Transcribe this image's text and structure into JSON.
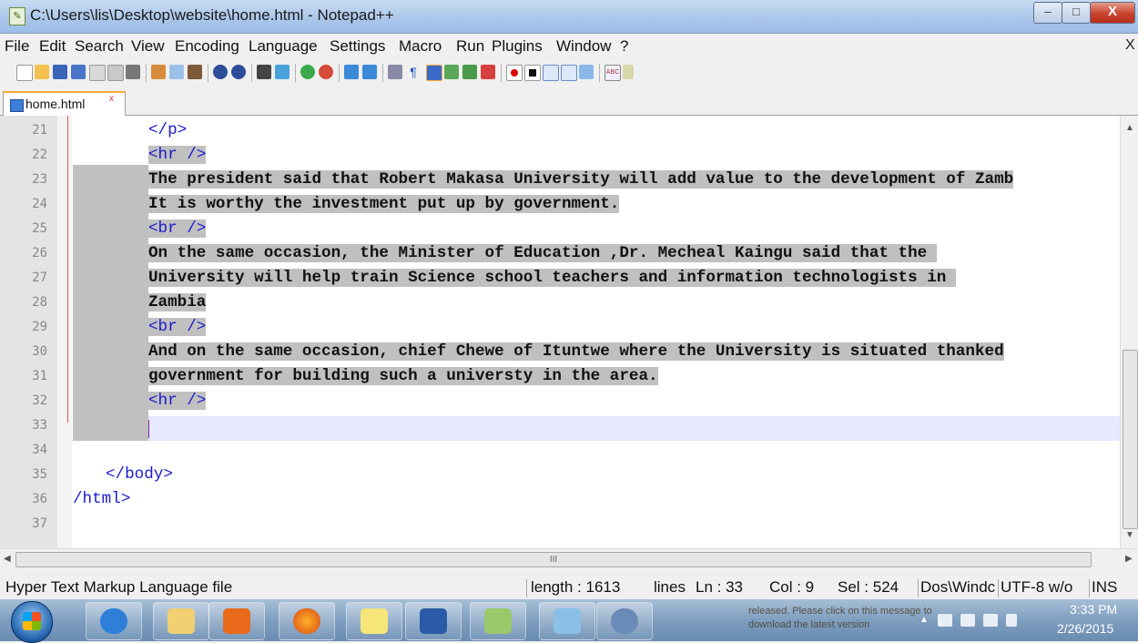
{
  "window": {
    "title": "C:\\Users\\lis\\Desktop\\website\\home.html - Notepad++",
    "minimize": "–",
    "maximize": "□",
    "close": "X"
  },
  "menu": {
    "items": [
      "File",
      "Edit",
      "Search",
      "View",
      "Encoding",
      "Language",
      "Settings",
      "Macro",
      "Run",
      "Plugins",
      "Window",
      "?"
    ],
    "close": "X"
  },
  "tabs": [
    {
      "label": "home.html",
      "close": "x"
    }
  ],
  "editor": {
    "lines": [
      {
        "num": "21",
        "text": "</p>",
        "indent": "        ",
        "kind": "tag"
      },
      {
        "num": "22",
        "text": "<hr />",
        "kind": "tag-sel"
      },
      {
        "num": "23",
        "text": "The president said that Robert Makasa University will add value to the development of Zamb",
        "kind": "text-sel"
      },
      {
        "num": "24",
        "text": "It is worthy the investment put up by government.",
        "kind": "text-sel"
      },
      {
        "num": "25",
        "text": "<br />",
        "kind": "tag-sel"
      },
      {
        "num": "26",
        "text": "On the same occasion, the Minister of Education ,Dr. Mecheal Kaingu said that the ",
        "kind": "text-sel"
      },
      {
        "num": "27",
        "text": "University will help train Science school teachers and information technologists in ",
        "kind": "text-sel"
      },
      {
        "num": "28",
        "text": "Zambia",
        "kind": "text-sel"
      },
      {
        "num": "29",
        "text": "<br />",
        "kind": "tag-sel"
      },
      {
        "num": "30",
        "text": "And on the same occasion, chief Chewe of Ituntwe where the University is situated thanked",
        "kind": "text-sel"
      },
      {
        "num": "31",
        "text": "government for building such a universty in the area.",
        "kind": "text-sel"
      },
      {
        "num": "32",
        "text": "<hr />",
        "kind": "tag-sel"
      },
      {
        "num": "33",
        "text": "",
        "kind": "current"
      },
      {
        "num": "34",
        "text": "",
        "kind": "blank"
      },
      {
        "num": "35",
        "text": "</body>",
        "kind": "tag"
      },
      {
        "num": "36",
        "text": "/html>",
        "kind": "tag"
      },
      {
        "num": "37",
        "text": "",
        "kind": "blank"
      }
    ],
    "hscroll_grip": "III"
  },
  "status": {
    "file_type": "Hyper Text Markup Language file",
    "length": "length : 1613",
    "lines": "lines",
    "ln": "Ln : 33",
    "col": "Col : 9",
    "sel": "Sel : 524",
    "eol": "Dos\\Windc",
    "encoding": "UTF-8 w/o",
    "mode": "INS"
  },
  "taskbar": {
    "notification": "released. Please click on this message to download the latest version",
    "time": "3:33 PM",
    "date": "2/26/2015"
  },
  "colors": {
    "selection": "#c0c0c0",
    "tag": "#1a1acc",
    "current_line": "#e8e8ff",
    "fold_margin": "#e05050"
  }
}
